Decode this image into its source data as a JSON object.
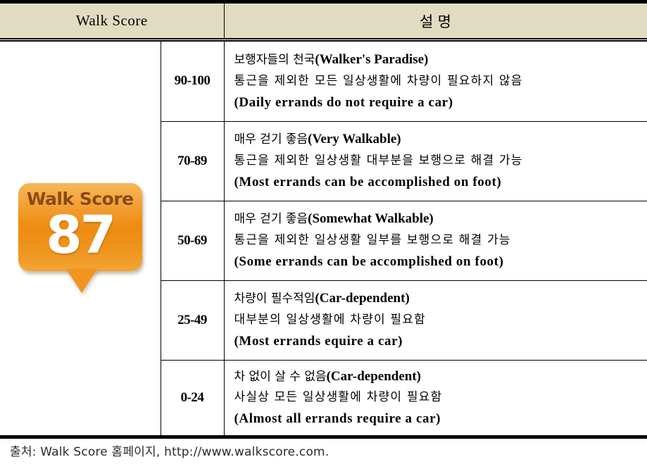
{
  "table": {
    "header": {
      "col_score_label": "Walk Score",
      "col_desc_label": "설 명"
    },
    "badge": {
      "title": "Walk Score",
      "value": "87",
      "body_color": "#f2941b",
      "tail_color": "#f2941e",
      "title_color": "#8a4a10",
      "value_color": "#ffffff"
    },
    "rows": [
      {
        "range": "90-100",
        "line1_ko": "보행자들의 천국",
        "line1_en": "(Walker's Paradise)",
        "line2_ko": "통근을 제외한 모든 일상생활에 차량이 필요하지 않음",
        "line3_en": "(Daily errands do not require a car)"
      },
      {
        "range": "70-89",
        "line1_ko": "매우 걷기 좋음",
        "line1_en": "(Very Walkable)",
        "line2_ko": "통근을 제외한 일상생활 대부분을 보행으로 해결 가능",
        "line3_en": "(Most errands can be accomplished on foot)"
      },
      {
        "range": "50-69",
        "line1_ko": "매우 걷기 좋음",
        "line1_en": "(Somewhat Walkable)",
        "line2_ko": "통근을 제외한 일상생활 일부를 보행으로 해결 가능",
        "line3_en": "(Some errands can be accomplished on foot)"
      },
      {
        "range": "25-49",
        "line1_ko": "차량이 필수적임",
        "line1_en": "(Car-dependent)",
        "line2_ko": "대부분의 일상생활에 차량이 필요함",
        "line3_en": "(Most errands equire a car)"
      },
      {
        "range": "0-24",
        "line1_ko": "차 없이 살 수 없음",
        "line1_en": "(Car-dependent)",
        "line2_ko": "사실상 모든 일상생활에 차량이 필요함",
        "line3_en": "(Almost all errands require a car)"
      }
    ]
  },
  "footer": {
    "source_text": "출처: Walk Score 홈페이지, http://www.walkscore.com."
  },
  "colors": {
    "header_bg": "#e0dcc1",
    "rule": "#000000",
    "page_bg": "#ffffff"
  }
}
